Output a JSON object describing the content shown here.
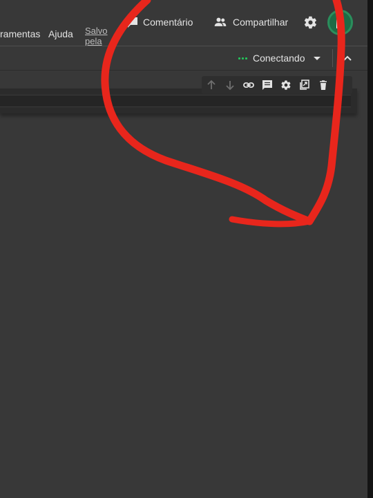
{
  "menu": {
    "tools": "ramentas",
    "help": "Ajuda"
  },
  "save_status": {
    "line1": "Salvo",
    "line2": "pela"
  },
  "header_actions": {
    "comment": "Comentário",
    "share": "Compartilhar"
  },
  "runtime": {
    "status": "Conectando",
    "status_color": "#23c35a"
  },
  "cell_toolbar": {
    "icons": [
      "arrow-up-icon",
      "arrow-down-icon",
      "link-icon",
      "comment-icon",
      "gear-icon",
      "mirror-cell-icon",
      "delete-icon"
    ]
  },
  "colors": {
    "background": "#383838",
    "annotation": "#e8261c",
    "avatar": "#1e6b46"
  }
}
